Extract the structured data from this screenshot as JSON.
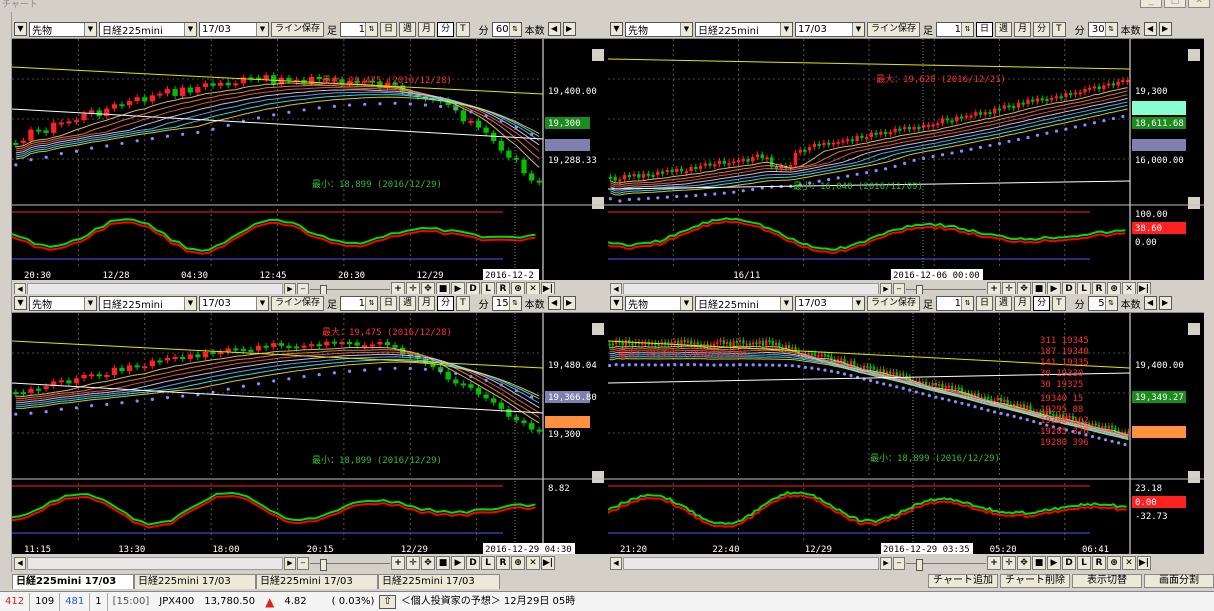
{
  "window": {
    "title": "チャート"
  },
  "panes": [
    {
      "symbol_type": "先物",
      "symbol": "日経225mini",
      "contract": "17/03",
      "line_save": "ライン保存",
      "foot": "足",
      "period_input": "1",
      "unit": "分",
      "interval": "60",
      "type_label": "本数",
      "period_buttons": {
        "day": "日",
        "week": "週",
        "month": "月",
        "minute": "分",
        "tick": "T"
      },
      "active_period": "minute",
      "max_label": "最大：19,475 (2016/12/28)",
      "min_label": "最小：18,899 (2016/12/29)",
      "price_axis": [
        "19,400.00",
        "19,300",
        "19,288.33"
      ],
      "x_axis": [
        "20:30",
        "12/28",
        "04:30",
        "12:45",
        "20:30",
        "12/29",
        "04:30"
      ],
      "cursor_date": "2016-12-2",
      "osc_labels": []
    },
    {
      "symbol_type": "先物",
      "symbol": "日経225mini",
      "contract": "17/03",
      "line_save": "ライン保存",
      "foot": "足",
      "period_input": "1",
      "unit": "分",
      "interval": "30",
      "type_label": "本数",
      "period_buttons": {
        "day": "日",
        "week": "週",
        "month": "月",
        "minute": "分",
        "tick": "T"
      },
      "active_period": "day",
      "max_label": "最大：19,620 (2016/12/21)",
      "min_label": "最小：16,040 (2016/11/09)",
      "price_axis": [
        "19,300",
        "18,611.68",
        "16,000.00"
      ],
      "x_axis": [
        "16/11"
      ],
      "cursor_date": "2016-12-06  00:00",
      "osc_labels": [
        "100.00",
        "38.60",
        "0.00"
      ]
    },
    {
      "symbol_type": "先物",
      "symbol": "日経225mini",
      "contract": "17/03",
      "line_save": "ライン保存",
      "foot": "足",
      "period_input": "1",
      "unit": "分",
      "interval": "15",
      "type_label": "本数",
      "period_buttons": {
        "day": "日",
        "week": "週",
        "month": "月",
        "minute": "分",
        "tick": "T"
      },
      "active_period": "minute",
      "max_label": "最大：19,475 (2016/12/28)",
      "min_label": "最小：18,899 (2016/12/29)",
      "price_axis": [
        "19,480.04",
        "19,366.80",
        "19,300"
      ],
      "x_axis": [
        "11:15",
        "13:30",
        "18:00",
        "20:15",
        "12/29",
        "02:"
      ],
      "cursor_date": "2016-12-29  04:30",
      "osc_labels": [
        "8.82"
      ]
    },
    {
      "symbol_type": "先物",
      "symbol": "日経225mini",
      "contract": "17/03",
      "line_save": "ライン保存",
      "foot": "足",
      "period_input": "1",
      "unit": "分",
      "interval": "5",
      "type_label": "本数",
      "period_buttons": {
        "day": "日",
        "week": "週",
        "month": "月",
        "minute": "分",
        "tick": "T"
      },
      "active_period": "minute",
      "max_label": "最大：19,475 (2016/12/28)",
      "min_label": "最小：18,899 (2016/12/29)",
      "price_axis": [
        "19,400.00",
        "19,349.27",
        "19,300"
      ],
      "x_axis": [
        "21:20",
        "22:40",
        "12/29",
        "01:20",
        "05:20",
        "06:41"
      ],
      "cursor_date": "2016-12-29  03:35",
      "osc_labels": [
        "23.18",
        "0.00",
        "-32.73"
      ],
      "board_asks": [
        [
          "311",
          "19345"
        ],
        [
          "187",
          "19340"
        ],
        [
          "141",
          "19335"
        ],
        [
          "30",
          "19330"
        ],
        [
          "30",
          "19325"
        ]
      ],
      "board_bids": [
        [
          "19340",
          "15"
        ],
        [
          "19295",
          "88"
        ],
        [
          "19290",
          "162"
        ],
        [
          "19285",
          "376"
        ],
        [
          "19280",
          "396"
        ]
      ]
    }
  ],
  "bottom_tabs": [
    "日経225mini 17/03",
    "日経225mini 17/03",
    "日経225mini 17/03",
    "日経225mini 17/03"
  ],
  "bottom_buttons": {
    "add": "チャート追加",
    "remove": "チャート削除",
    "display": "表示切替",
    "split": "画面分割"
  },
  "status": {
    "up": "412",
    "down": "109",
    "flat": "481",
    "one": "1",
    "time": "[15:00]",
    "index": "JPX400",
    "value": "13,780.50",
    "change": "4.82",
    "pct": "( 0.03%)",
    "ticker": "＜個人投資家の予想＞ 12月29日 05時"
  },
  "colors": {
    "up": "#ff2020",
    "down": "#00c000",
    "macd_fast": "#00e000",
    "macd_slow": "#ff0000",
    "ma_band": "#7fb8ff",
    "dots": "#8a8aff",
    "yellow": "#e6e600"
  }
}
